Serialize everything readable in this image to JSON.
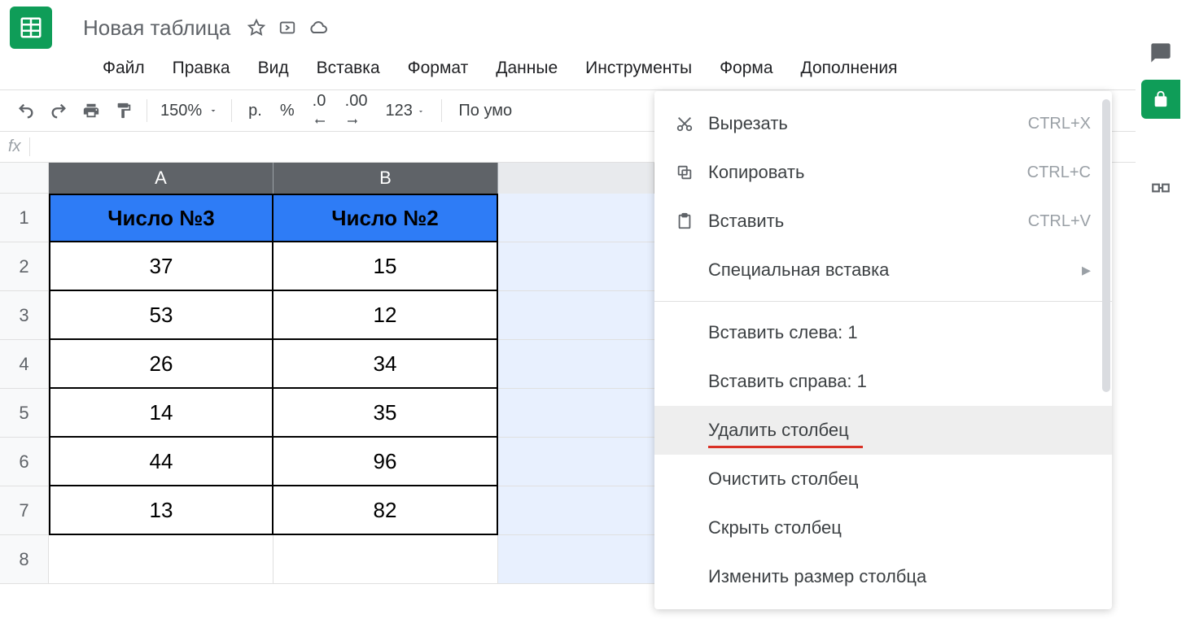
{
  "doc": {
    "title": "Новая таблица"
  },
  "menubar": [
    "Файл",
    "Правка",
    "Вид",
    "Вставка",
    "Формат",
    "Данные",
    "Инструменты",
    "Форма",
    "Дополнения"
  ],
  "toolbar": {
    "zoom": "150%",
    "currency": "р.",
    "percent": "%",
    "dec_dec": ".0",
    "dec_inc": ".00",
    "num_fmt": "123",
    "font": "По умо"
  },
  "table": {
    "columns": [
      "A",
      "B"
    ],
    "extra_col": "",
    "headers": [
      "Число №3",
      "Число №2"
    ],
    "rows": [
      [
        "37",
        "15"
      ],
      [
        "53",
        "12"
      ],
      [
        "26",
        "34"
      ],
      [
        "14",
        "35"
      ],
      [
        "44",
        "96"
      ],
      [
        "13",
        "82"
      ]
    ],
    "row_numbers": [
      "1",
      "2",
      "3",
      "4",
      "5",
      "6",
      "7",
      "8"
    ]
  },
  "context_menu": {
    "cut": {
      "label": "Вырезать",
      "shortcut": "CTRL+X"
    },
    "copy": {
      "label": "Копировать",
      "shortcut": "CTRL+C"
    },
    "paste": {
      "label": "Вставить",
      "shortcut": "CTRL+V"
    },
    "paste_sp": {
      "label": "Специальная вставка"
    },
    "ins_left": {
      "label": "Вставить слева: 1"
    },
    "ins_right": {
      "label": "Вставить справа: 1"
    },
    "del_col": {
      "label": "Удалить столбец"
    },
    "clear_col": {
      "label": "Очистить столбец"
    },
    "hide_col": {
      "label": "Скрыть столбец"
    },
    "resize_col": {
      "label": "Изменить размер столбца"
    }
  }
}
